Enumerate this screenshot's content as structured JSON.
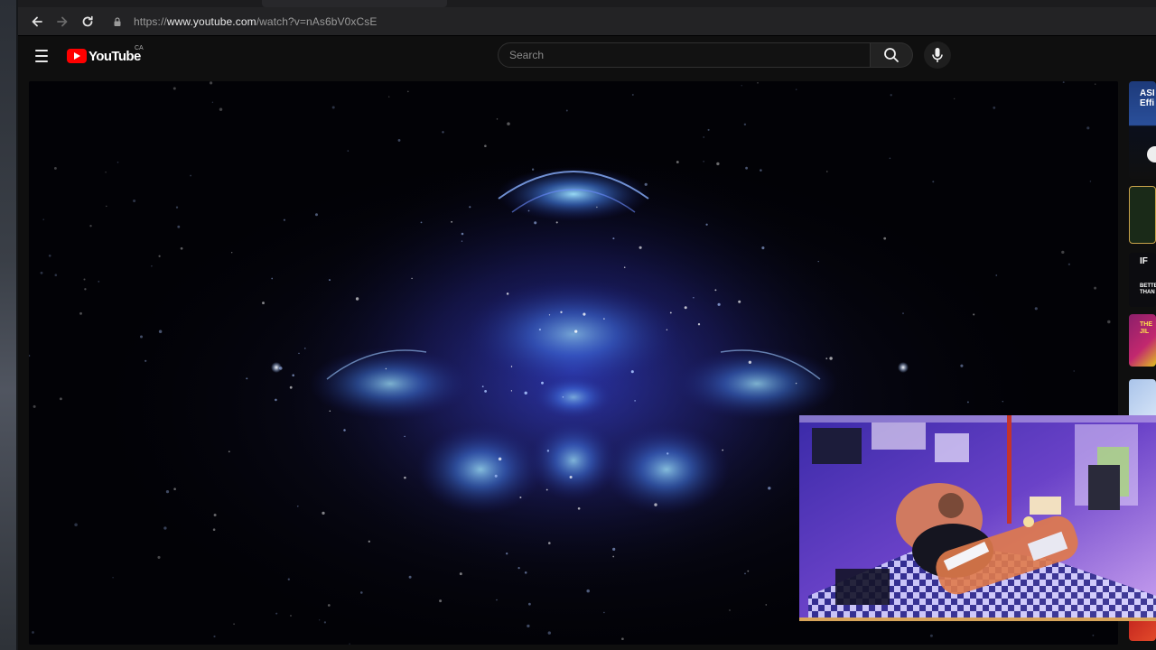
{
  "browser": {
    "url_prefix": "https://",
    "url_host": "www.youtube.com",
    "url_path": "/watch?v=nAs6bV0xCsE"
  },
  "youtube": {
    "logo_text": "YouTube",
    "country_code": "CA",
    "search_placeholder": "Search"
  },
  "sidebar": {
    "thumb1_text": "ASI Effi",
    "thumb3_text": "IF",
    "thumb3_sub": "BETTE THAN",
    "thumb4_text": "THE JIL"
  },
  "colors": {
    "youtube_red": "#ff0000",
    "nebula_blue": "#4f6bff",
    "webcam_purple": "#6a3ec2"
  }
}
